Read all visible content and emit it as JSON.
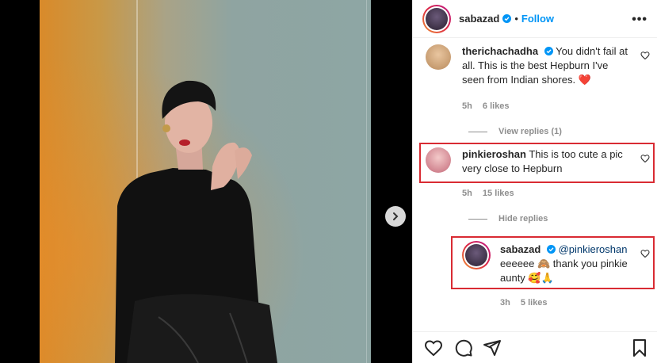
{
  "post": {
    "next_icon": "chevron-right-icon"
  },
  "header": {
    "username": "sabazad",
    "separator": "•",
    "follow_label": "Follow",
    "more_label": "•••"
  },
  "comments": [
    {
      "username": "therichachadha",
      "verified": true,
      "text": "You didn't fail at all. This is the best Hepburn I've seen from Indian shores. ❤️",
      "time": "5h",
      "likes": "6 likes",
      "reply_toggle": "View replies (1)"
    },
    {
      "username": "pinkieroshan",
      "verified": false,
      "text": "This is too cute a pic very close to Hepburn",
      "time": "5h",
      "likes": "15 likes",
      "reply_toggle": "Hide replies"
    },
    {
      "username": "sabazad",
      "verified": true,
      "mention": "@pinkieroshan",
      "text": "eeeeee 🙈 thank you pinkie aunty 🥰🙏",
      "time": "3h",
      "likes": "5 likes"
    }
  ],
  "actions": [
    "heart-icon",
    "comment-icon",
    "share-icon",
    "bookmark-icon"
  ],
  "colors": {
    "follow": "#0095f6",
    "highlight": "#d92b33",
    "verified": "#0095f6"
  }
}
